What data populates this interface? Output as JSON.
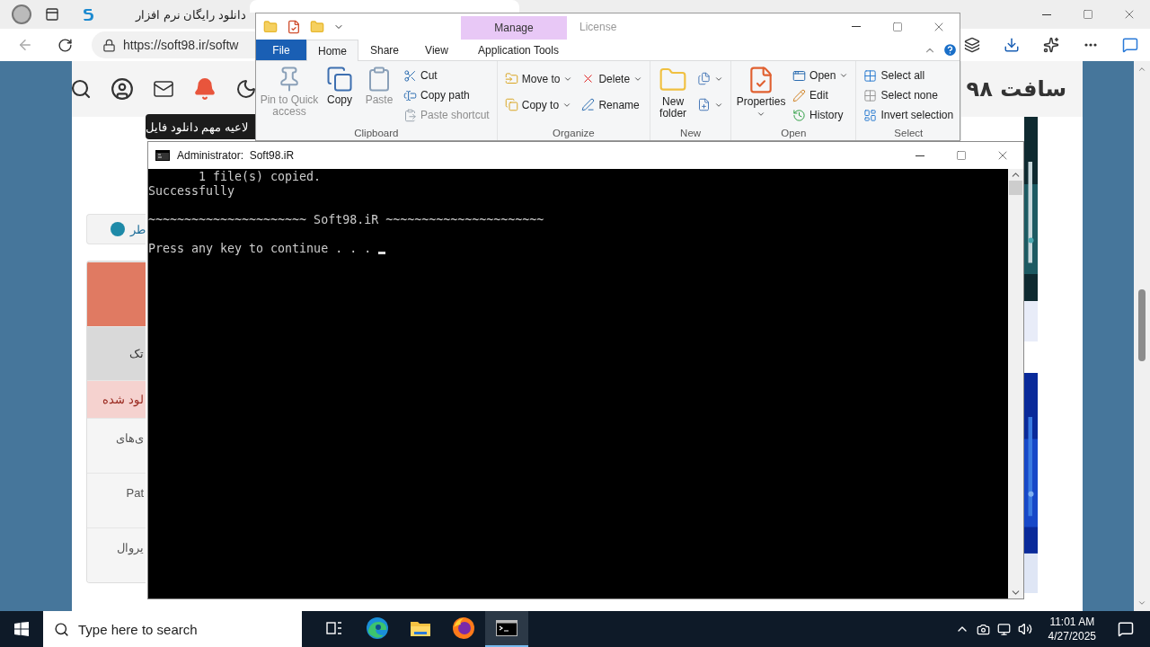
{
  "browser": {
    "tabs": [
      {
        "title": "دانلود رایگان نرم افزار",
        "selected": false
      },
      {
        "selected": true
      }
    ],
    "address": "https://soft98.ir/softw",
    "tooltip": "لاعیه مهم دانلود فایل",
    "logo": "سافت ۹۸",
    "side_tab": "طر",
    "side_rows": [
      {
        "kind": "header"
      },
      {
        "kind": "muted",
        "label": "تک"
      },
      {
        "kind": "alert",
        "label": "لود شده"
      },
      {
        "kind": "plain",
        "label": "ی‌های"
      },
      {
        "kind": "plain",
        "label": "Pat"
      },
      {
        "kind": "plain",
        "label": "یروال"
      }
    ]
  },
  "explorer": {
    "title": "License",
    "context_header": "Manage",
    "tabs": [
      {
        "label": "File",
        "kind": "file",
        "selected": false
      },
      {
        "label": "Home",
        "kind": "normal",
        "selected": true
      },
      {
        "label": "Share",
        "kind": "normal",
        "selected": false
      },
      {
        "label": "View",
        "kind": "normal",
        "selected": false
      },
      {
        "label": "Application Tools",
        "kind": "context",
        "selected": false
      }
    ],
    "groups": [
      {
        "label": "Clipboard",
        "items": [
          {
            "kind": "large",
            "label": "Pin to Quick access",
            "disabled": true,
            "dropdown": false
          },
          {
            "kind": "large",
            "label": "Copy",
            "disabled": false,
            "dropdown": false
          },
          {
            "kind": "large",
            "label": "Paste",
            "disabled": true,
            "dropdown": false
          },
          {
            "kind": "stack",
            "items": [
              {
                "label": "Cut",
                "disabled": false,
                "dropdown": false
              },
              {
                "label": "Copy path",
                "disabled": false,
                "dropdown": false
              },
              {
                "label": "Paste shortcut",
                "disabled": true,
                "dropdown": false
              }
            ]
          }
        ]
      },
      {
        "label": "Organize",
        "items": [
          {
            "kind": "stack",
            "items": [
              {
                "label": "Move to",
                "disabled": false,
                "dropdown": true
              },
              {
                "label": "Copy to",
                "disabled": false,
                "dropdown": true
              }
            ]
          },
          {
            "kind": "stack",
            "items": [
              {
                "label": "Delete",
                "disabled": false,
                "dropdown": true
              },
              {
                "label": "Rename",
                "disabled": false,
                "dropdown": false
              }
            ]
          }
        ]
      },
      {
        "label": "New",
        "items": [
          {
            "kind": "large",
            "label": "New folder",
            "disabled": false,
            "dropdown": false
          },
          {
            "kind": "stack",
            "items": [
              {
                "dropdown": true
              },
              {
                "dropdown": true
              }
            ]
          }
        ]
      },
      {
        "label": "Open",
        "items": [
          {
            "kind": "large",
            "label": "Properties",
            "disabled": false,
            "dropdown": true
          },
          {
            "kind": "stack",
            "items": [
              {
                "label": "Open",
                "disabled": false,
                "dropdown": true
              },
              {
                "label": "Edit",
                "disabled": false,
                "dropdown": false
              },
              {
                "label": "History",
                "disabled": false,
                "dropdown": false
              }
            ]
          }
        ]
      },
      {
        "label": "Select",
        "items": [
          {
            "kind": "stack",
            "items": [
              {
                "label": "Select all",
                "disabled": false,
                "dropdown": false
              },
              {
                "label": "Select none",
                "disabled": false,
                "dropdown": false
              },
              {
                "label": "Invert selection",
                "disabled": false,
                "dropdown": false
              }
            ]
          }
        ]
      }
    ]
  },
  "console": {
    "title": "Administrator:  Soft98.iR",
    "paragraphs": [
      [
        "       1 file(s) copied.",
        "Successfully"
      ],
      [
        "~~~~~~~~~~~~~~~~~~~~~~ Soft98.iR ~~~~~~~~~~~~~~~~~~~~~~"
      ],
      [
        "Press any key to continue . . . "
      ]
    ]
  },
  "taskbar": {
    "search_placeholder": "Type here to search",
    "apps": [
      {
        "kind": "taskview",
        "selected": false
      },
      {
        "kind": "edge",
        "selected": false
      },
      {
        "kind": "explorer",
        "selected": false
      },
      {
        "kind": "firefox",
        "selected": false
      },
      {
        "kind": "terminal",
        "selected": true
      }
    ],
    "time": "11:01 AM",
    "date": "4/27/2025"
  }
}
